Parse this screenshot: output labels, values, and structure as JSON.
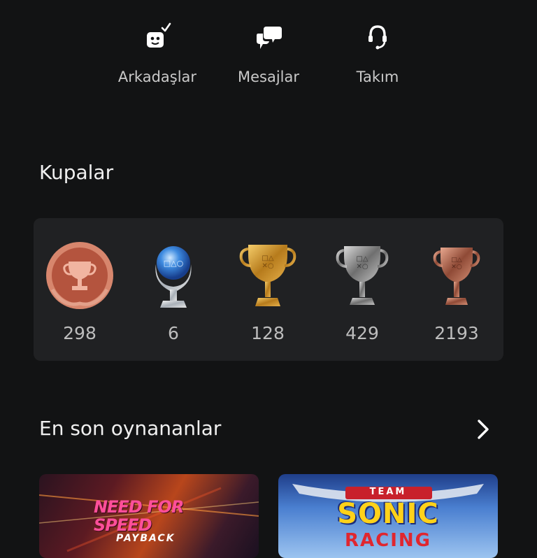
{
  "quick_actions": [
    {
      "label": "Arkadaşlar",
      "icon": "friends-icon"
    },
    {
      "label": "Mesajlar",
      "icon": "messages-icon"
    },
    {
      "label": "Takım",
      "icon": "headset-icon"
    }
  ],
  "trophies": {
    "title": "Kupalar",
    "items": [
      {
        "type": "level",
        "count": "298",
        "icon": "trophy-level-icon"
      },
      {
        "type": "platinum",
        "count": "6",
        "icon": "platinum-trophy-icon"
      },
      {
        "type": "gold",
        "count": "128",
        "icon": "gold-trophy-icon"
      },
      {
        "type": "silver",
        "count": "429",
        "icon": "silver-trophy-icon"
      },
      {
        "type": "bronze",
        "count": "2193",
        "icon": "bronze-trophy-icon"
      }
    ]
  },
  "recent": {
    "title": "En son oynananlar",
    "games": [
      {
        "title_art": "NEED FOR SPEED",
        "subtitle_art": "PAYBACK"
      },
      {
        "title_art": "SONIC",
        "top_art": "TEAM",
        "bottom_art": "RACING"
      }
    ]
  },
  "colors": {
    "background": "#121314",
    "card": "#202123",
    "text": "#d9d9d9"
  }
}
